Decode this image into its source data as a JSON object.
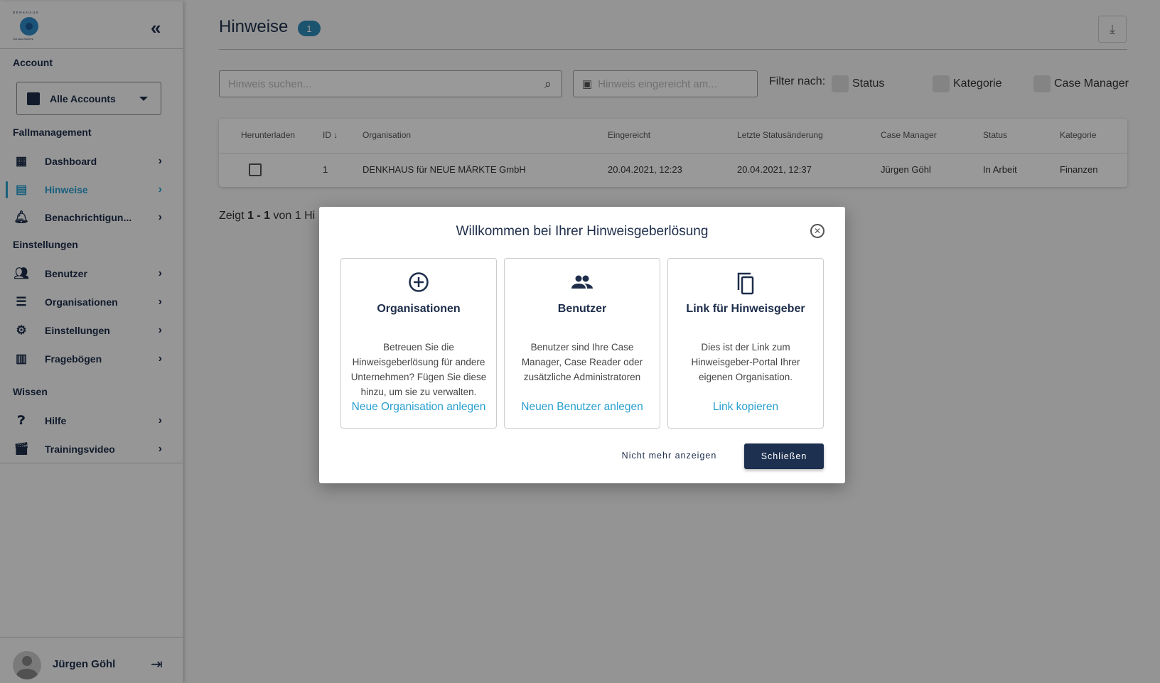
{
  "brand": {
    "logo_text": "DENKHAUS",
    "logo_sub": "FÜR NEUE MÄRKTE",
    "accent": "#2aa0d0",
    "navy": "#1d2d4a"
  },
  "sidebar": {
    "account_heading": "Account",
    "account_select": "Alle Accounts",
    "sections": [
      {
        "heading": "Fallmanagement",
        "items": [
          {
            "label": "Dashboard",
            "icon": "dashboard-icon"
          },
          {
            "label": "Hinweise",
            "icon": "document-icon",
            "active": true
          },
          {
            "label": "Benachrichtigun...",
            "icon": "bell-icon"
          }
        ]
      },
      {
        "heading": "Einstellungen",
        "items": [
          {
            "label": "Benutzer",
            "icon": "users-icon"
          },
          {
            "label": "Organisationen",
            "icon": "list-icon"
          },
          {
            "label": "Einstellungen",
            "icon": "gear-icon"
          },
          {
            "label": "Fragebögen",
            "icon": "form-icon"
          }
        ]
      },
      {
        "heading": "Wissen",
        "items": [
          {
            "label": "Hilfe",
            "icon": "help-icon"
          },
          {
            "label": "Trainingsvideo",
            "icon": "film-icon"
          }
        ]
      }
    ],
    "user_name": "Jürgen Göhl"
  },
  "header": {
    "title": "Hinweise",
    "count": "1"
  },
  "toolbar": {
    "search_placeholder": "Hinweis suchen...",
    "date_placeholder": "Hinweis eingereicht am...",
    "filter_label": "Filter nach:",
    "filters": [
      "Status",
      "Kategorie",
      "Case Manager"
    ]
  },
  "table": {
    "columns": [
      "Herunterladen",
      "ID",
      "Organisation",
      "Eingereicht",
      "Letzte Statusänderung",
      "Case Manager",
      "Status",
      "Kategorie"
    ],
    "rows": [
      {
        "id": "1",
        "organisation": "DENKHAUS für NEUE MÄRKTE GmbH",
        "eingereicht": "20.04.2021, 12:23",
        "letzte": "20.04.2021, 12:37",
        "case_manager": "Jürgen Göhl",
        "status": "In Arbeit",
        "kategorie": "Finanzen"
      }
    ]
  },
  "pagination": {
    "prefix": "Zeigt",
    "range": "1 - 1",
    "suffix": "von 1 Hi"
  },
  "modal": {
    "title": "Willkommen bei Ihrer Hinweisgeberlösung",
    "cards": [
      {
        "title": "Organisationen",
        "text": "Betreuen Sie die Hinweisgeberlösung für andere Unternehmen? Fügen Sie diese hinzu, um sie zu verwalten.",
        "link": "Neue Organisation anlegen",
        "icon": "add-circle-icon"
      },
      {
        "title": "Benutzer",
        "text": "Benutzer sind Ihre Case Manager, Case Reader oder zusätzliche Administratoren",
        "link": "Neuen Benutzer anlegen",
        "icon": "users-icon"
      },
      {
        "title": "Link für Hinweisgeber",
        "text": "Dies ist der Link zum Hinweisgeber-Portal Ihrer eigenen Organisation.",
        "link": "Link kopieren",
        "icon": "copy-icon"
      }
    ],
    "dont_show": "Nicht mehr anzeigen",
    "close": "Schließen"
  }
}
